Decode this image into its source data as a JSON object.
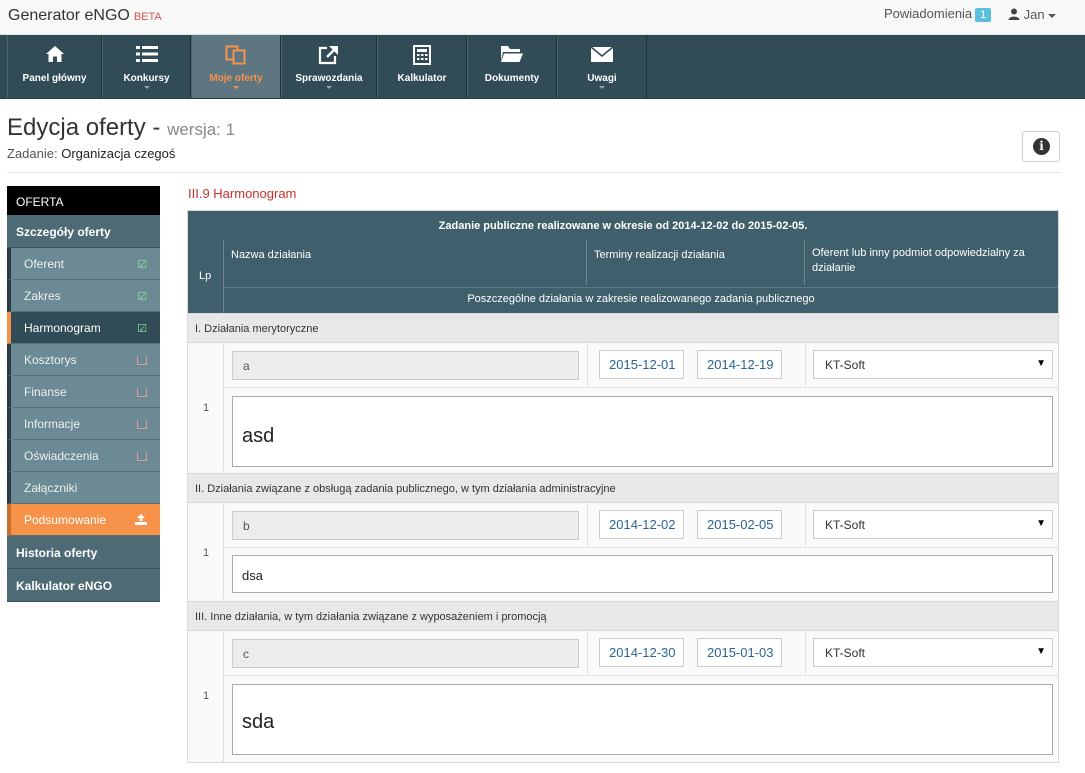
{
  "topbar": {
    "brand": "Generator eNGO",
    "beta": "BETA",
    "notifications_label": "Powiadomienia",
    "notifications_count": "1",
    "user_name": "Jan"
  },
  "nav": {
    "items": [
      {
        "label": "Panel główny",
        "icon": "home-icon",
        "dropdown": false,
        "active": false
      },
      {
        "label": "Konkursy",
        "icon": "list-icon",
        "dropdown": true,
        "active": false
      },
      {
        "label": "Moje oferty",
        "icon": "copy-icon",
        "dropdown": true,
        "active": true
      },
      {
        "label": "Sprawozdania",
        "icon": "external-link-icon",
        "dropdown": true,
        "active": false
      },
      {
        "label": "Kalkulator",
        "icon": "calculator-icon",
        "dropdown": false,
        "active": false
      },
      {
        "label": "Dokumenty",
        "icon": "folder-open-icon",
        "dropdown": false,
        "active": false
      },
      {
        "label": "Uwagi",
        "icon": "envelope-icon",
        "dropdown": true,
        "active": false
      }
    ]
  },
  "page": {
    "title": "Edycja oferty -",
    "version_label": "wersja: 1",
    "task_label": "Zadanie:",
    "task_value": "Organizacja czegoś"
  },
  "sidebar": {
    "header": "OFERTA",
    "details": "Szczegóły oferty",
    "items": [
      {
        "label": "Oferent",
        "status": "done"
      },
      {
        "label": "Zakres",
        "status": "done"
      },
      {
        "label": "Harmonogram",
        "status": "done",
        "active": true
      },
      {
        "label": "Kosztorys",
        "status": "empty"
      },
      {
        "label": "Finanse",
        "status": "empty"
      },
      {
        "label": "Informacje",
        "status": "empty"
      },
      {
        "label": "Oświadczenia",
        "status": "empty"
      },
      {
        "label": "Załączniki",
        "status": "none"
      },
      {
        "label": "Podsumowanie",
        "status": "upload"
      }
    ],
    "history": "Historia oferty",
    "calculator": "Kalkulator eNGO"
  },
  "section": {
    "title": "III.9 Harmonogram",
    "period_text": "Zadanie publiczne realizowane w okresie od 2014-12-02 do 2015-02-05.",
    "col_lp": "Lp",
    "col_name": "Nazwa działania",
    "col_terms": "Terminy realizacji działania",
    "col_responsible": "Oferent lub inny podmiot odpowiedzialny za działanie",
    "subheader": "Poszczególne działania w zakresie realizowanego zadania publicznego"
  },
  "groups": [
    {
      "title": "I. Działania merytoryczne",
      "lp": "1",
      "name": "a",
      "date_from": "2015-12-01",
      "date_to": "2014-12-19",
      "responsible": "KT-Soft",
      "description": "asd"
    },
    {
      "title": "II. Działania związane z obsługą zadania publicznego, w tym działania administracyjne",
      "lp": "1",
      "name": "b",
      "date_from": "2014-12-02",
      "date_to": "2015-02-05",
      "responsible": "KT-Soft",
      "description": "dsa"
    },
    {
      "title": "III. Inne działania, w tym działania związane z wyposażeniem i promocją",
      "lp": "1",
      "name": "c",
      "date_from": "2014-12-30",
      "date_to": "2015-01-03",
      "responsible": "KT-Soft",
      "description": "sda"
    }
  ]
}
